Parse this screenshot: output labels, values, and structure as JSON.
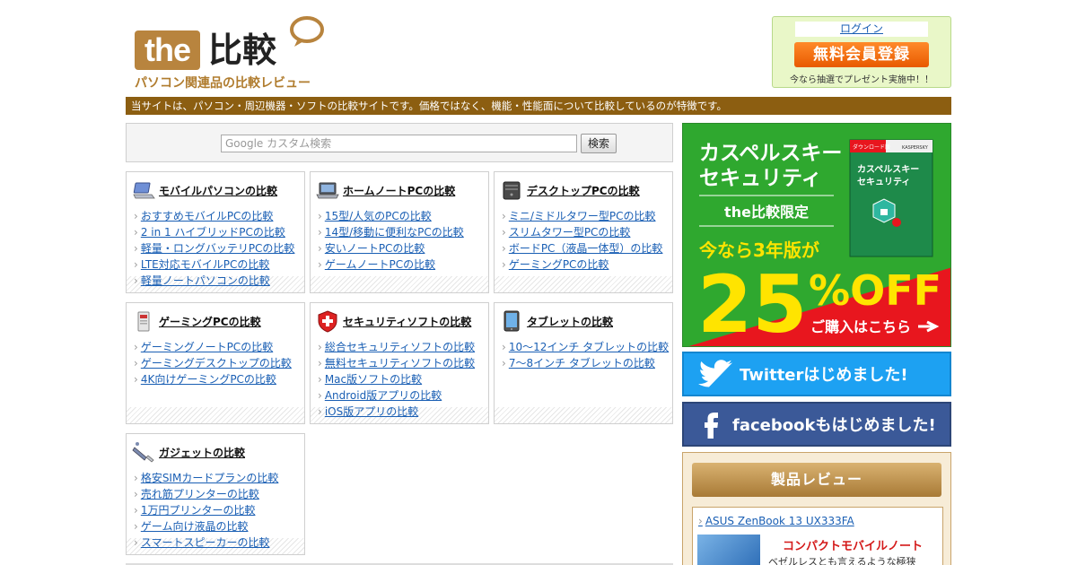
{
  "header": {
    "logo_the": "the",
    "logo_hikaku": "比較",
    "tagline": "パソコン関連品の比較レビュー"
  },
  "member": {
    "login": "ログイン",
    "register": "無料会員登録",
    "note": "今なら抽選でプレゼント実施中！！"
  },
  "site_banner": "当サイトは、パソコン・周辺機器・ソフトの比較サイトです。価格ではなく、機能・性能面について比較しているのが特徴です。",
  "search": {
    "placeholder": "Google カスタム検索",
    "button": "検索"
  },
  "categories": [
    {
      "title": "モバイルパソコンの比較",
      "icon": "laptop-mobile-icon",
      "links": [
        "おすすめモバイルPCの比較",
        "2 in 1 ハイブリッドPCの比較",
        "軽量・ロングバッテリPCの比較",
        "LTE対応モバイルPCの比較",
        "軽量ノートパソコンの比較"
      ]
    },
    {
      "title": "ホームノートPCの比較",
      "icon": "laptop-home-icon",
      "links": [
        "15型/人気のPCの比較",
        "14型/移動に便利なPCの比較",
        "安いノートPCの比較",
        "ゲームノートPCの比較"
      ]
    },
    {
      "title": "デスクトップPCの比較",
      "icon": "desktop-tower-icon",
      "links": [
        "ミニ/ミドルタワー型PCの比較",
        "スリムタワー型PCの比較",
        "ボードPC（液晶一体型）の比較",
        "ゲーミングPCの比較"
      ]
    },
    {
      "title": "ゲーミングPCの比較",
      "icon": "gaming-pc-icon",
      "links": [
        "ゲーミングノートPCの比較",
        "ゲーミングデスクトップの比較",
        "4K向けゲーミングPCの比較"
      ]
    },
    {
      "title": "セキュリティソフトの比較",
      "icon": "security-shield-icon",
      "links": [
        "総合セキュリティソフトの比較",
        "無料セキュリティソフトの比較",
        "Mac版ソフトの比較",
        "Android版アプリの比較",
        "iOS版アプリの比較"
      ]
    },
    {
      "title": "タブレットの比較",
      "icon": "tablet-icon",
      "links": [
        "10～12インチ タブレットの比較",
        "7～8インチ タブレットの比較"
      ]
    },
    {
      "title": "ガジェットの比較",
      "icon": "usb-gadget-icon",
      "links": [
        "格安SIMカードプランの比較",
        "売れ筋プリンターの比較",
        "1万円プリンターの比較",
        "ゲーム向け液晶の比較",
        "スマートスピーカーの比較"
      ]
    }
  ],
  "ad": {
    "line1": "カスペルスキー",
    "line2": "セキュリティ",
    "limited": "the比較限定",
    "now": "今なら3年版が",
    "big": "25",
    "off": "%OFF",
    "cta": "ご購入はこちら",
    "box_tag": "ダウンロード版",
    "box_brand": "KASPERSKY",
    "box_name1": "カスペルスキー",
    "box_name2": "セキュリティ",
    "accent_color": "#2fa82f"
  },
  "sns": {
    "twitter": "Twitterはじめました!",
    "facebook": "facebookもはじめました!"
  },
  "review": {
    "heading": "製品レビュー",
    "product": "ASUS ZenBook 13 UX333FA",
    "catch": "コンパクトモバイルノート",
    "desc": "ベゼルレスとも言えるような極狭"
  }
}
